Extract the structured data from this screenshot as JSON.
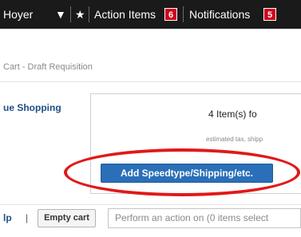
{
  "header": {
    "user_name": "Hoyer",
    "user_caret": "▼",
    "star": "★",
    "action_items_label": "Action Items",
    "action_items_count": "6",
    "notifications_label": "Notifications",
    "notifications_count": "5"
  },
  "breadcrumb": "Cart - Draft Requisition",
  "left": {
    "continue_shopping": "ue Shopping"
  },
  "summary": {
    "items_text": "4 Item(s)  fo",
    "estimate_note": "estimated tax, shipp",
    "add_button_label": "Add Speedtype/Shipping/etc."
  },
  "bottom": {
    "help_link": "lp",
    "pipe": "|",
    "empty_cart_label": "Empty cart",
    "action_select_value": "Perform an action on (0 items select"
  },
  "colors": {
    "nav_bg": "#1a1a1a",
    "badge_red": "#d0021b",
    "primary_button": "#2a6fb8",
    "annotation_red": "#e01919",
    "link_blue": "#214f87"
  }
}
